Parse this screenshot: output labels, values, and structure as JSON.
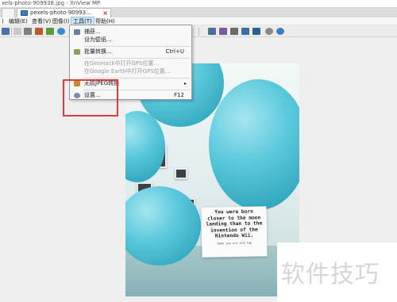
{
  "window": {
    "title": "xels-photo-909938.jpg - XnView MP"
  },
  "tabs": [
    {
      "label": ""
    },
    {
      "label": "pexels-photo-90993…"
    }
  ],
  "menubar": {
    "items": [
      {
        "label": ")"
      },
      {
        "label": "编辑(E)"
      },
      {
        "label": "查看(V)"
      },
      {
        "label": "图像(I)"
      },
      {
        "label": "工具(T)"
      },
      {
        "label": "帮助(H)"
      }
    ],
    "active_index": 4
  },
  "tools_menu": {
    "items": [
      {
        "label": "捕获...",
        "shortcut": "",
        "enabled": true,
        "icon": "capture-icon"
      },
      {
        "label": "设为壁纸...",
        "shortcut": "",
        "enabled": true,
        "icon": ""
      },
      {
        "label": "批量转换...",
        "shortcut": "Ctrl+U",
        "enabled": true,
        "icon": "batch-convert-icon"
      },
      {
        "label": "在GeoHack中打开GPS位置...",
        "shortcut": "",
        "enabled": false,
        "icon": ""
      },
      {
        "label": "在Google Earth中打开GPS位置...",
        "shortcut": "",
        "enabled": false,
        "icon": ""
      },
      {
        "label": "无损JPEG转换",
        "shortcut": "",
        "enabled": true,
        "icon": "jpeg-lossless-icon",
        "submenu": true,
        "arrow": "▸"
      },
      {
        "label": "设置...",
        "shortcut": "F12",
        "enabled": true,
        "icon": "settings-gear-icon"
      }
    ]
  },
  "photo_card": {
    "text": "You were born closer to the moon landing than to the invention of the Nintendo Wii.",
    "small": "Damn you are old fam"
  },
  "tab_close_glyph": "×",
  "watermark": {
    "text": "软件技巧"
  },
  "colors": {
    "highlight_box": "#e23b3b",
    "menu_active": "#cce4f7",
    "balloon": "#5cc9dc"
  }
}
